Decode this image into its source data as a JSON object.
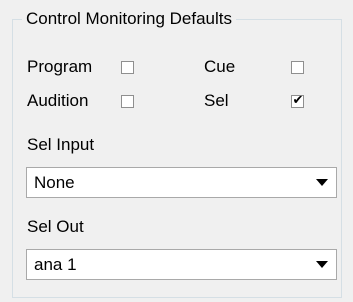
{
  "group": {
    "title": "Control Monitoring Defaults"
  },
  "checkboxes": {
    "program": {
      "label": "Program",
      "checked": false
    },
    "cue": {
      "label": "Cue",
      "checked": false
    },
    "audition": {
      "label": "Audition",
      "checked": false
    },
    "sel": {
      "label": "Sel",
      "checked": true,
      "mark": "✔"
    }
  },
  "sel_input": {
    "label": "Sel Input",
    "value": "None"
  },
  "sel_out": {
    "label": "Sel Out",
    "value": "ana 1"
  },
  "icons": {
    "checkmark": "checkmark-icon",
    "dropdown_arrow": "chevron-down-icon"
  }
}
